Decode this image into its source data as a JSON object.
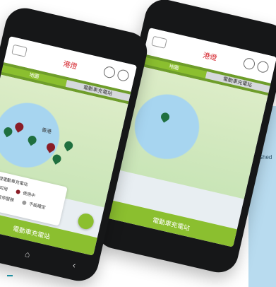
{
  "app": {
    "brand": "港燈",
    "tabs": [
      "地圖",
      "電動車充電站"
    ],
    "bottom_label": "電動車充電站",
    "legend_title": "港燈電動車充電站",
    "legend_items": [
      "可用",
      "使用中",
      "暫停服務",
      "不能確定"
    ],
    "map_label": "香港",
    "side_label": "g Shed"
  },
  "colors": {
    "accent_green": "#8bbf2f",
    "pin_green": "#1f6f3f",
    "pin_red": "#8a1c26"
  }
}
